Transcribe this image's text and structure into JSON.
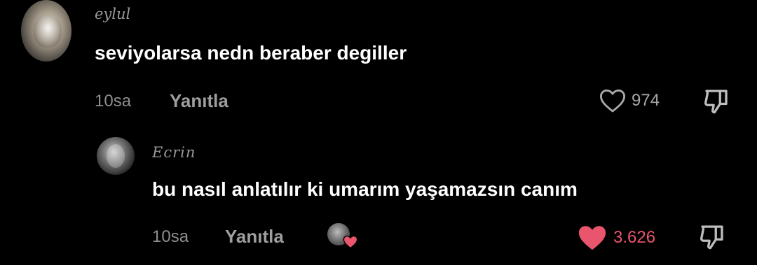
{
  "comment": {
    "username": "eylul",
    "text": "seviyolarsa nedn beraber degiller",
    "time": "10sa",
    "reply_label": "Yanıtla",
    "likes": "974",
    "liked": false
  },
  "reply": {
    "username": "Ecrin",
    "text": "bu nasıl anlatılır ki umarım yaşamazsın canım",
    "time": "10sa",
    "reply_label": "Yanıtla",
    "likes": "3.626",
    "liked": true,
    "liked_by_creator": true
  },
  "colors": {
    "background": "#000000",
    "liked_heart": "#e8556d",
    "muted_text": "#8e8e8e"
  },
  "icons": {
    "like": "heart-outline-icon",
    "liked": "heart-filled-icon",
    "dislike": "thumbs-down-icon"
  }
}
